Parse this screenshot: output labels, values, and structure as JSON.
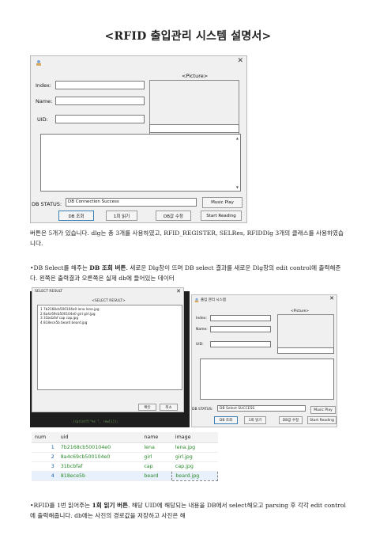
{
  "title": "<RFID 출입관리 시스템 설명서>",
  "dialog_main": {
    "picture_label": "<Picture>",
    "index_label": "Index:",
    "name_label": "Name:",
    "uid_label": "UID:",
    "db_status_label": "DB STATUS:",
    "db_status_value": "DB Connection Success",
    "buttons": {
      "db_select": "DB 조회",
      "read_once": "1회 읽기",
      "db_edit": "DB값 수정",
      "music_play": "Music Play",
      "start_reading": "Start Reading"
    }
  },
  "para1": "버튼은 5개가 있습니다. dlg는 총 3개를 사용하였고, RFID_REGISTER, SELRes, RFIDDlg 3개의 클래스를 사용하였습니다.",
  "para2": {
    "prefix": "•DB Select를 해주는 ",
    "bold": "DB 조회 버튼",
    "suffix": ". 새로운 Dlg창이 뜨며 DB select 결과를 새로운 Dlg창의 edit control에 출력해준다. 왼쪽은 출력결과 오른쪽은 실제 db에 들어있는 데이터"
  },
  "dialog_select": {
    "title": "SELECT RESULT",
    "result_label": "<SELECT RESULT>",
    "lines": [
      "1  7b2168cb500104e0  lena  lena.jpg",
      "2  8a4c69cb500104e0  girl  girl.jpg",
      "3  31bcbfaf  cap  cap.jpg",
      "4  818ece5b  beard  beard.jpg"
    ],
    "ok": "확인",
    "cancel": "취소",
    "code": "//printf(\"%s \", row[i]);"
  },
  "dialog_small": {
    "title": "출입 관리 시스템",
    "picture_label": "<Picture>",
    "index_label": "Index:",
    "name_label": "Name:",
    "uid_label": "UID:",
    "db_status_label": "DB STATUS:",
    "db_status_value": "DB Select SUCCESS",
    "buttons": {
      "db_select": "DB 조회",
      "read_once": "1회 읽기",
      "db_edit": "DB값 수정",
      "music_play": "Music Play",
      "start_reading": "Start Reading"
    }
  },
  "table": {
    "headers": [
      "num",
      "uid",
      "name",
      "image"
    ],
    "rows": [
      [
        "1",
        "7b2168cb500104e0",
        "lena",
        "lena.jpg"
      ],
      [
        "2",
        "8a4c69cb500104e0",
        "girl",
        "girl.jpg"
      ],
      [
        "3",
        "31bcbfaf",
        "cap",
        "cap.jpg"
      ],
      [
        "4",
        "818ece5b",
        "beard",
        "beard.jpg"
      ]
    ]
  },
  "para3": {
    "prefix": "•RFID를 1번 읽어주는 ",
    "bold": "1회 읽기 버튼",
    "suffix": ". 해당 UID에 해당되는 내용을 DB에서 select해오고 parsing 후 각각 edit control에 출력해줍니다. db에는 사진의 경로값을 저장하고 사진은 해"
  },
  "colors": {
    "table_text": "#2a8a2a",
    "table_num": "#1b5fa8",
    "focus_border": "#3c7fb1"
  }
}
